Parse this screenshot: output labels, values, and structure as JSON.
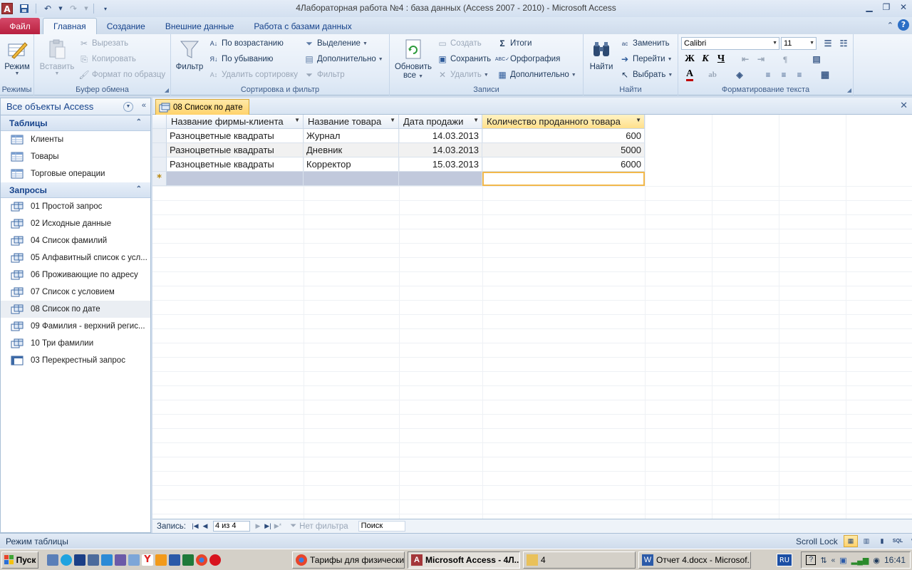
{
  "window": {
    "title": "4Лабораторная работа №4 : база данных (Access 2007 - 2010)  -  Microsoft Access",
    "app_icon_letter": "A"
  },
  "ribbon_tabs": {
    "file": "Файл",
    "tabs": [
      "Главная",
      "Создание",
      "Внешние данные",
      "Работа с базами данных"
    ],
    "active_index": 0
  },
  "ribbon": {
    "groups": {
      "views": "Режимы",
      "clipboard": "Буфер обмена",
      "sort_filter": "Сортировка и фильтр",
      "records": "Записи",
      "find": "Найти",
      "text_format": "Форматирование текста"
    },
    "view_button": "Режим",
    "paste_button": "Вставить",
    "cut": "Вырезать",
    "copy": "Копировать",
    "format_painter": "Формат по образцу",
    "filter_button": "Фильтр",
    "sort_ascending": "По возрастанию",
    "sort_descending": "По убыванию",
    "remove_sort": "Удалить сортировку",
    "selection": "Выделение",
    "advanced": "Дополнительно",
    "toggle_filter": "Фильтр",
    "refresh_line1": "Обновить",
    "refresh_line2": "все",
    "new_record": "Создать",
    "save_record": "Сохранить",
    "delete_record": "Удалить",
    "totals": "Итоги",
    "spelling": "Орфография",
    "records_more": "Дополнительно",
    "find_button": "Найти",
    "replace": "Заменить",
    "goto": "Перейти",
    "select": "Выбрать",
    "font_name": "Calibri",
    "font_size": "11",
    "bold": "Ж",
    "italic": "К",
    "underline": "Ч",
    "font_color_letter": "A"
  },
  "nav_pane": {
    "header": "Все объекты Access",
    "groups": [
      {
        "name": "Таблицы",
        "items": [
          "Клиенты",
          "Товары",
          "Торговые операции"
        ]
      },
      {
        "name": "Запросы",
        "items": [
          "01 Простой запрос",
          "02 Исходные данные",
          "04 Список фамилий",
          "05 Алфавитный список с усл...",
          "06 Проживающие по адресу",
          "07 Список с условием",
          "08 Список по дате",
          "09 Фамилия - верхний регис...",
          "10 Три фамилии",
          "03 Перекрестный запрос"
        ]
      }
    ],
    "selected_item": "08 Список по дате"
  },
  "document": {
    "tab_title": "08 Список по дате",
    "columns": [
      "Название фирмы-клиента",
      "Название товара",
      "Дата продажи",
      "Количество проданного товара"
    ],
    "rows": [
      [
        "Разноцветные квадраты",
        "Журнал",
        "14.03.2013",
        "600"
      ],
      [
        "Разноцветные квадраты",
        "Дневник",
        "14.03.2013",
        "5000"
      ],
      [
        "Разноцветные квадраты",
        "Корректор",
        "15.03.2013",
        "6000"
      ]
    ],
    "new_row_marker": "*"
  },
  "record_nav": {
    "label": "Запись:",
    "current": "4 из 4",
    "filter_status": "Нет фильтра",
    "search_placeholder": "Поиск"
  },
  "status_bar": {
    "mode": "Режим таблицы",
    "scroll_lock": "Scroll Lock"
  },
  "taskbar": {
    "start": "Пуск",
    "tasks": [
      "Тарифы для физически...",
      "Microsoft Access - 4Л...",
      "4",
      "Отчет 4.docx - Microsof..."
    ],
    "active_task_index": 1,
    "language": "RU",
    "clock": "16:41"
  },
  "colors": {
    "file_tab": "#c42b4c",
    "active_header": "#ffe08a",
    "new_row": "#c1c9dc",
    "focus_border": "#f2b84b"
  }
}
